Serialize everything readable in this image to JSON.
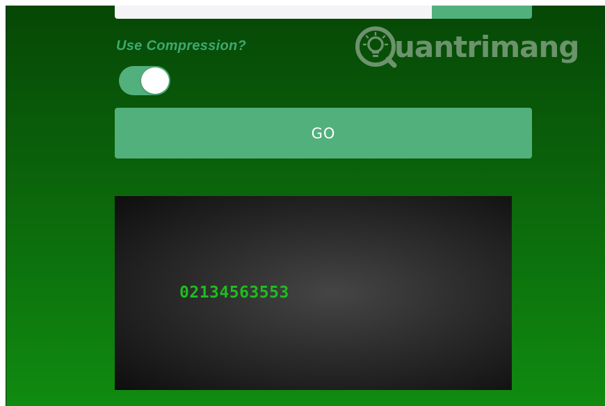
{
  "form": {
    "input_value": "",
    "compression_label": "Use Compression?",
    "compression_enabled": true,
    "go_label": "GO"
  },
  "output": {
    "text": "02134563553"
  },
  "watermark": {
    "text": "uantrimang",
    "icon": "lightbulb-q-icon"
  },
  "colors": {
    "accent": "#52b07c",
    "output_text": "#1ebd1e",
    "background_top": "#064706",
    "background_bottom": "#108b10"
  }
}
